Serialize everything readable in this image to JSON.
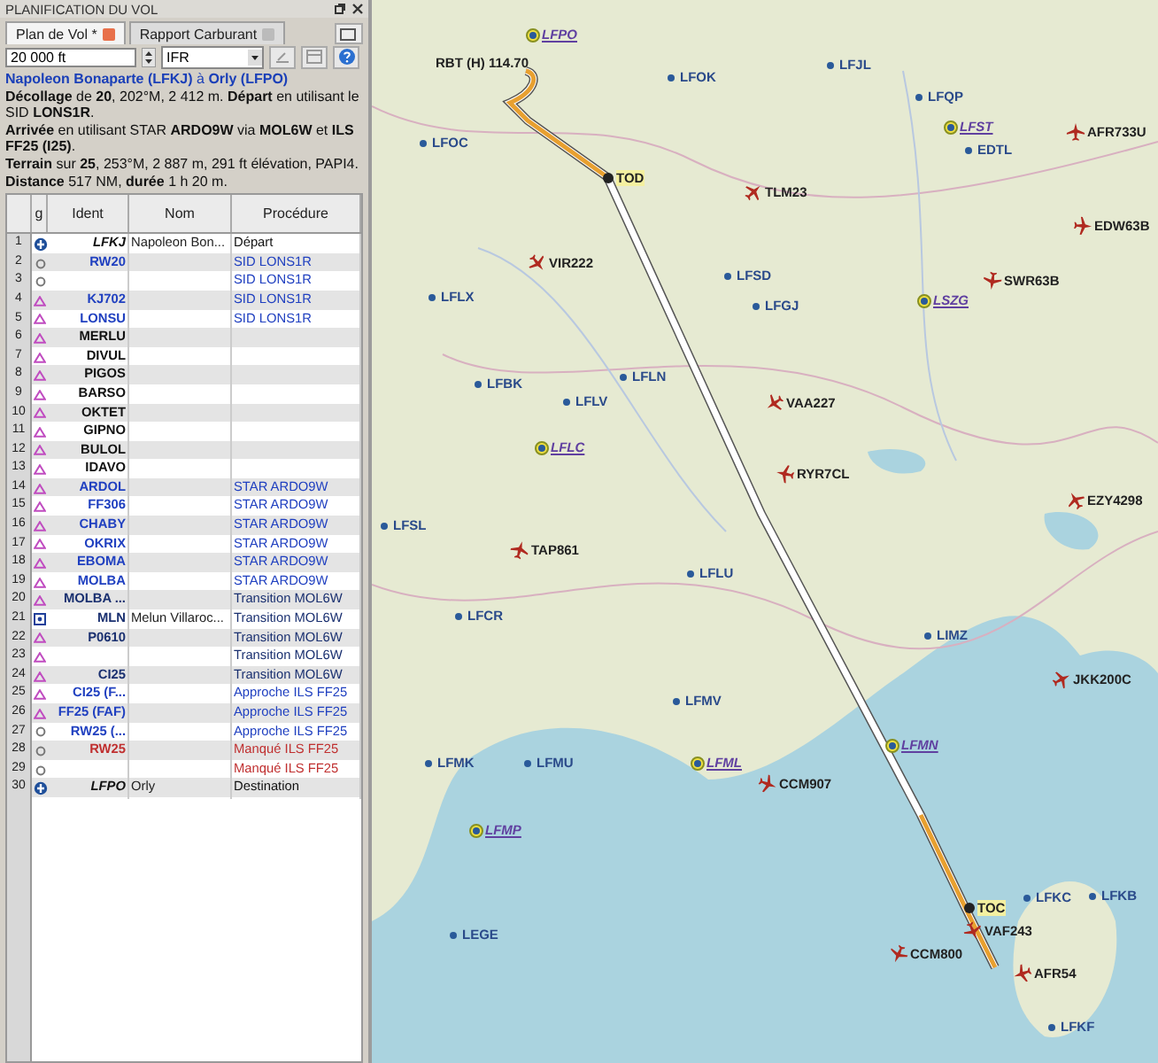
{
  "panel": {
    "title": "PLANIFICATION DU VOL",
    "tabs": [
      {
        "label": "Plan de Vol *",
        "selected": true
      },
      {
        "label": "Rapport Carburant",
        "selected": false
      }
    ],
    "altitude": "20 000 ft",
    "flight_rules": "IFR",
    "route_title": "**Napoleon Bonaparte (LFKJ)** à **Orly (LFPO)**",
    "summary": [
      "**Décollage** de **20**, 202°M, 2 412 m. **Départ** en utilisant le SID **LONS1R**.",
      "**Arrivée** en utilisant STAR **ARDO9W** via **MOL6W** et **ILS FF25 (I25)**.",
      "**Terrain** sur **25**, 253°M, 2 887 m, 291 ft élévation, PAPI4.",
      "**Distance** 517 NM, **durée** 1 h 20 m."
    ],
    "columns": [
      "g",
      "Ident",
      "Nom",
      "Procédure"
    ],
    "rows": [
      {
        "n": "1",
        "kind": "airport",
        "ident": "LFKJ",
        "name": "Napoleon Bon...",
        "procedure": "Départ",
        "color": "#111111"
      },
      {
        "n": "2",
        "kind": "runway",
        "ident": "RW20",
        "procedure": "SID LONS1R",
        "color": "#2040c0"
      },
      {
        "n": "3",
        "kind": "runway",
        "procedure": "SID LONS1R",
        "color": "#2040c0"
      },
      {
        "n": "4",
        "kind": "waypoint",
        "ident": "KJ702",
        "procedure": "SID LONS1R",
        "color": "#2040c0"
      },
      {
        "n": "5",
        "kind": "waypoint",
        "ident": "LONSU",
        "procedure": "SID LONS1R",
        "color": "#2040c0"
      },
      {
        "n": "6",
        "kind": "waypoint",
        "ident": "MERLU",
        "color": "#111111"
      },
      {
        "n": "7",
        "kind": "waypoint",
        "ident": "DIVUL",
        "color": "#111111"
      },
      {
        "n": "8",
        "kind": "waypoint",
        "ident": "PIGOS",
        "color": "#111111"
      },
      {
        "n": "9",
        "kind": "waypoint",
        "ident": "BARSO",
        "color": "#111111"
      },
      {
        "n": "10",
        "kind": "waypoint",
        "ident": "OKTET",
        "color": "#111111"
      },
      {
        "n": "11",
        "kind": "waypoint",
        "ident": "GIPNO",
        "color": "#111111"
      },
      {
        "n": "12",
        "kind": "waypoint",
        "ident": "BULOL",
        "color": "#111111"
      },
      {
        "n": "13",
        "kind": "waypoint",
        "ident": "IDAVO",
        "color": "#111111"
      },
      {
        "n": "14",
        "kind": "waypoint",
        "ident": "ARDOL",
        "procedure": "STAR ARDO9W",
        "color": "#2040c0"
      },
      {
        "n": "15",
        "kind": "waypoint",
        "ident": "FF306",
        "procedure": "STAR ARDO9W",
        "color": "#2040c0"
      },
      {
        "n": "16",
        "kind": "waypoint",
        "ident": "CHABY",
        "procedure": "STAR ARDO9W",
        "color": "#2040c0"
      },
      {
        "n": "17",
        "kind": "waypoint",
        "ident": "OKRIX",
        "procedure": "STAR ARDO9W",
        "color": "#2040c0"
      },
      {
        "n": "18",
        "kind": "waypoint",
        "ident": "EBOMA",
        "procedure": "STAR ARDO9W",
        "color": "#2040c0"
      },
      {
        "n": "19",
        "kind": "waypoint",
        "ident": "MOLBA",
        "procedure": "STAR ARDO9W",
        "color": "#2040c0"
      },
      {
        "n": "20",
        "kind": "waypoint",
        "ident": "MOLBA ...",
        "procedure": "Transition MOL6W",
        "color": "#1a3070"
      },
      {
        "n": "21",
        "kind": "vor",
        "ident": "MLN",
        "name": "Melun Villaroc...",
        "procedure": "Transition MOL6W",
        "color": "#1a3070"
      },
      {
        "n": "22",
        "kind": "waypoint",
        "ident": "P0610",
        "procedure": "Transition MOL6W",
        "color": "#1a3070"
      },
      {
        "n": "23",
        "kind": "waypoint",
        "procedure": "Transition MOL6W",
        "color": "#1a3070"
      },
      {
        "n": "24",
        "kind": "waypoint",
        "ident": "CI25",
        "procedure": "Transition MOL6W",
        "color": "#1a3070"
      },
      {
        "n": "25",
        "kind": "waypoint",
        "ident": "CI25 (F...",
        "procedure": "Approche ILS FF25",
        "color": "#2040c0"
      },
      {
        "n": "26",
        "kind": "waypoint",
        "ident": "FF25 (FAF)",
        "procedure": "Approche ILS FF25",
        "color": "#2040c0"
      },
      {
        "n": "27",
        "kind": "runway",
        "ident": "RW25 (...",
        "procedure": "Approche ILS FF25",
        "color": "#2040c0"
      },
      {
        "n": "28",
        "kind": "runway",
        "ident": "RW25",
        "procedure": "Manqué ILS FF25",
        "color": "#c03030"
      },
      {
        "n": "29",
        "kind": "runway",
        "procedure": "Manqué ILS FF25",
        "color": "#c03030"
      },
      {
        "n": "30",
        "kind": "airport",
        "ident": "LFPO",
        "name": "Orly",
        "procedure": "Destination",
        "color": "#111111"
      }
    ]
  },
  "map": {
    "route_marks": [
      {
        "label": "RBT (H) 114.70",
        "kind": "navaid"
      },
      {
        "label": "TOD",
        "kind": "tod"
      },
      {
        "label": "TOC",
        "kind": "toc"
      }
    ],
    "aircraft": [
      "AFR733U",
      "TLM23",
      "EDW63B",
      "VIR222",
      "SWR63B",
      "VAA227",
      "RYR7CL",
      "EZY4298",
      "TAP861",
      "JKK200C",
      "CCM907",
      "VAF243",
      "CCM800",
      "AFR54"
    ],
    "airports": [
      {
        "label": "LFPO",
        "towered": true
      },
      {
        "label": "LFJL",
        "towered": false
      },
      {
        "label": "LFOK",
        "towered": false
      },
      {
        "label": "LFQP",
        "towered": false
      },
      {
        "label": "LFST",
        "towered": true
      },
      {
        "label": "LFOC",
        "towered": false
      },
      {
        "label": "EDTL",
        "towered": false
      },
      {
        "label": "LFSD",
        "towered": false
      },
      {
        "label": "LFLX",
        "towered": false
      },
      {
        "label": "LSZG",
        "towered": true
      },
      {
        "label": "LFGJ",
        "towered": false
      },
      {
        "label": "LFLN",
        "towered": false
      },
      {
        "label": "LFBK",
        "towered": false
      },
      {
        "label": "LFLV",
        "towered": false
      },
      {
        "label": "LFLC",
        "towered": true
      },
      {
        "label": "LFSL",
        "towered": false
      },
      {
        "label": "LFLU",
        "towered": false
      },
      {
        "label": "LFCR",
        "towered": false
      },
      {
        "label": "LIMZ",
        "towered": false
      },
      {
        "label": "LFMV",
        "towered": false
      },
      {
        "label": "LFMN",
        "towered": true
      },
      {
        "label": "LFMK",
        "towered": false
      },
      {
        "label": "LFMU",
        "towered": false
      },
      {
        "label": "LFML",
        "towered": true
      },
      {
        "label": "LFMP",
        "towered": true
      },
      {
        "label": "LFKB",
        "towered": false
      },
      {
        "label": "LFKC",
        "towered": false
      },
      {
        "label": "LEGE",
        "towered": false
      },
      {
        "label": "LFKF",
        "towered": false
      }
    ]
  }
}
